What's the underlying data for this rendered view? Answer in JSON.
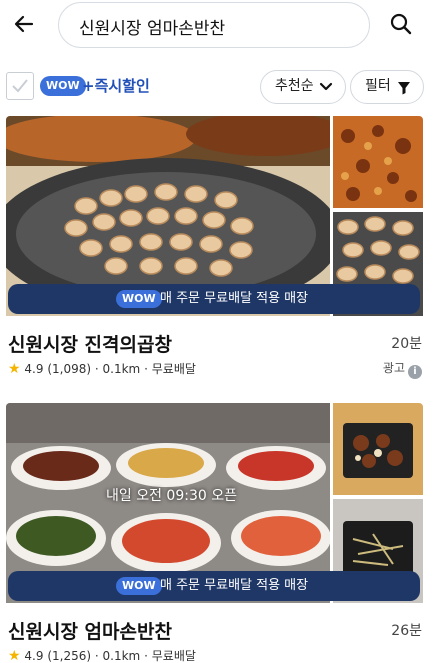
{
  "header": {
    "search_query": "신원시장 엄마손반찬",
    "back_icon": "arrow-left-icon",
    "search_icon": "search-icon"
  },
  "filter_bar": {
    "wow_badge": "WOW",
    "instant_discount_label": "+즉시할인",
    "sort_label": "추천순",
    "filter_label": "필터"
  },
  "stores": [
    {
      "promo_badge": "WOW",
      "promo_text": "매 주문 무료배달 적용 매장",
      "name": "신원시장 진격의곱창",
      "delivery_time": "20분",
      "rating": "4.9",
      "review_count": "(1,098)",
      "distance": "0.1km",
      "delivery_fee": "무료배달",
      "ad_label": "광고",
      "overlay_text": ""
    },
    {
      "promo_badge": "WOW",
      "promo_text": "매 주문 무료배달 적용 매장",
      "name": "신원시장 엄마손반찬",
      "delivery_time": "26분",
      "rating": "4.9",
      "review_count": "(1,256)",
      "distance": "0.1km",
      "delivery_fee": "무료배달",
      "ad_label": "",
      "overlay_text": "내일 오전 09:30 오픈"
    }
  ],
  "colors": {
    "accent_blue": "#3b6fd9",
    "promo_bar": "#1f3766",
    "star": "#f5b400"
  }
}
